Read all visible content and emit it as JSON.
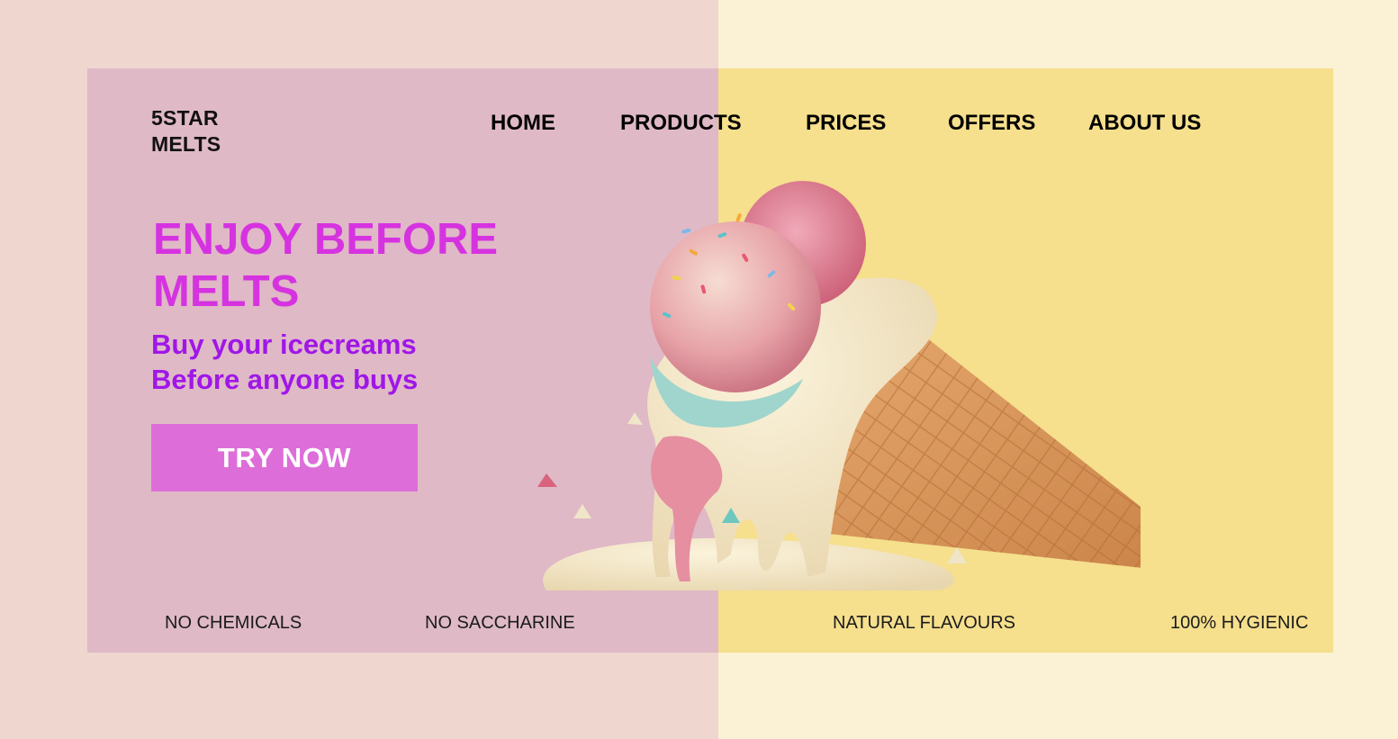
{
  "brand": {
    "logo_line1": "5STAR",
    "logo_line2": "MELTS"
  },
  "nav": {
    "items": [
      {
        "label": "HOME"
      },
      {
        "label": "PRODUCTS"
      },
      {
        "label": "PRICES"
      },
      {
        "label": "OFFERS"
      },
      {
        "label": "ABOUT US"
      }
    ]
  },
  "hero": {
    "headline": "ENJOY BEFORE MELTS",
    "subline_1": "Buy your icecreams",
    "subline_2": "Before anyone buys",
    "cta_label": "TRY NOW",
    "image": "melting-ice-cream-cone"
  },
  "features": [
    "NO CHEMICALS",
    "NO SACCHARINE",
    "NATURAL FLAVOURS",
    "100% HYGIENIC"
  ],
  "colors": {
    "page_left_bg": "#efd6cf",
    "page_right_bg": "#fbf1d5",
    "card_left_bg": "#dfb9c6",
    "card_right_bg": "#f6df8d",
    "headline": "#d633e0",
    "subline": "#a016e8",
    "cta_bg": "#dd6ed9"
  }
}
